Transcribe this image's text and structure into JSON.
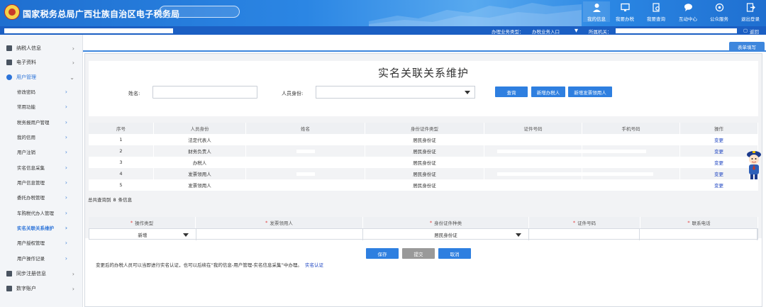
{
  "header": {
    "title": "国家税务总局广西壮族自治区电子税务局",
    "search_placeholder": "",
    "nav": [
      {
        "label": "我的信息",
        "icon": "user-icon"
      },
      {
        "label": "我要办税",
        "icon": "monitor-icon"
      },
      {
        "label": "我要查询",
        "icon": "document-search-icon"
      },
      {
        "label": "互动中心",
        "icon": "chat-icon"
      },
      {
        "label": "公众服务",
        "icon": "service-icon"
      },
      {
        "label": "退出登录",
        "icon": "logout-icon"
      }
    ]
  },
  "subbar": {
    "business_type_label": "办理业务类型：",
    "business_type_value": "办税业务入口",
    "tax_office_label": "所属机关：",
    "return_label": "返回"
  },
  "sidebar": {
    "items": [
      {
        "label": "纳税人信息",
        "icon": "id-card-icon"
      },
      {
        "label": "电子资料",
        "icon": "file-icon"
      },
      {
        "label": "用户管理",
        "icon": "users-icon"
      }
    ],
    "sub_items": [
      {
        "label": "修改密码"
      },
      {
        "label": "常用功能"
      },
      {
        "label": "税务报用户管理"
      },
      {
        "label": "我的信用"
      },
      {
        "label": "用户注销"
      },
      {
        "label": "实名信息采集"
      },
      {
        "label": "用户信息管理"
      },
      {
        "label": "委托办税管理"
      },
      {
        "label": "车购税代办人管理"
      },
      {
        "label": "实名关联关系维护"
      },
      {
        "label": "用户授权管理"
      },
      {
        "label": "用户操作记录"
      }
    ],
    "bottom_items": [
      {
        "label": "同步注册信息",
        "icon": "sync-icon"
      },
      {
        "label": "数字账户",
        "icon": "account-icon"
      }
    ]
  },
  "main": {
    "tab_label": "表单填写",
    "page_title": "实名关联关系维护",
    "form": {
      "name_label": "姓名:",
      "name_value": "",
      "identity_label": "人员身份:",
      "identity_value": "",
      "query_button": "查询",
      "add_taxpayer_button": "新增办税人",
      "add_invoice_user_button": "新增发票领用人"
    },
    "table": {
      "headers": [
        "序号",
        "人员身份",
        "姓名",
        "身份证件类型",
        "证件号码",
        "手机号码",
        "操作"
      ],
      "rows": [
        {
          "no": "1",
          "identity": "法定代表人",
          "name": "",
          "id_type": "居民身份证",
          "id_no": "",
          "phone": "",
          "action": "变更"
        },
        {
          "no": "2",
          "identity": "财务负责人",
          "name": "",
          "id_type": "居民身份证",
          "id_no": "",
          "phone": "",
          "action": "变更"
        },
        {
          "no": "3",
          "identity": "办税人",
          "name": "",
          "id_type": "居民身份证",
          "id_no": "",
          "phone": "",
          "action": "变更"
        },
        {
          "no": "4",
          "identity": "发票领用人",
          "name": "",
          "id_type": "居民身份证",
          "id_no": "",
          "phone": "",
          "action": "变更"
        },
        {
          "no": "5",
          "identity": "发票领用人",
          "name": "",
          "id_type": "居民身份证",
          "id_no": "",
          "phone": "",
          "action": "变更"
        }
      ],
      "total_prefix": "总共查询到",
      "total_count": "8",
      "total_suffix": "条信息"
    },
    "add_form": {
      "headers": [
        "操作类型",
        "发票领用人",
        "身份证件种类",
        "证件号码",
        "联系电话"
      ],
      "operation_type": "新增",
      "invoice_user": "",
      "id_kind": "居民身份证",
      "id_number": "",
      "phone": ""
    },
    "buttons": {
      "save": "保存",
      "submit": "提交",
      "cancel": "取消"
    },
    "note": "变更后的办税人员可以当即进行实名认证，也可以后续在“我的信息-用户管理-实名信息采集”中办理。",
    "note_link": "实名认证"
  },
  "colors": {
    "header_blue": "#2b86e4",
    "subbar_blue": "#1b5fc3",
    "button_blue": "#2e7fe0",
    "link_blue": "#1840c0"
  }
}
